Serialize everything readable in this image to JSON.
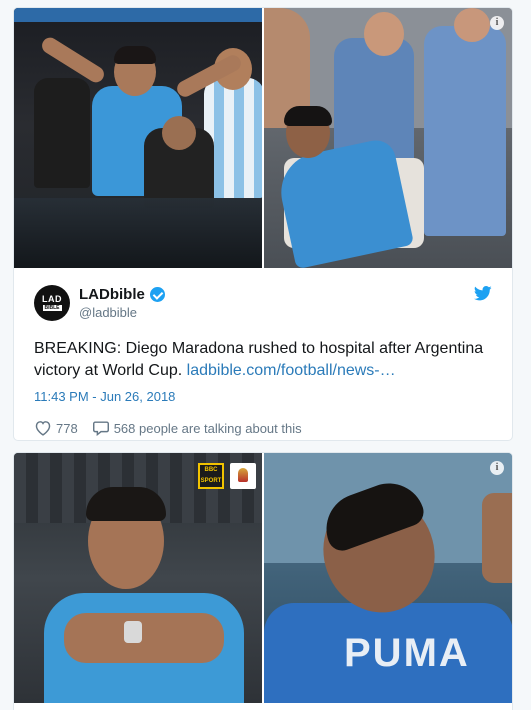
{
  "tweet": {
    "avatar_line1": "LAD",
    "avatar_line2": "BIBLE",
    "display_name": "LADbible",
    "handle": "@ladbible",
    "text": "BREAKING: Diego Maradona rushed to hospital after Argentina victory at World Cup. ",
    "link": "ladbible.com/football/news-…",
    "timestamp": "11:43 PM - Jun 26, 2018",
    "likes": "778",
    "talking": "568 people are talking about this",
    "info_icon": "i",
    "colors": {
      "link": "#2b7bb9",
      "verified": "#1da1f2",
      "meta": "#657786"
    }
  },
  "second_card": {
    "info_icon": "i",
    "bbc_line1": "BBC",
    "bbc_line2": "SPORT",
    "shirt_text": "PUMA"
  },
  "icons": [
    "info-icon",
    "verified-badge-icon",
    "twitter-bird-icon",
    "heart-icon",
    "comment-bubble-icon"
  ]
}
